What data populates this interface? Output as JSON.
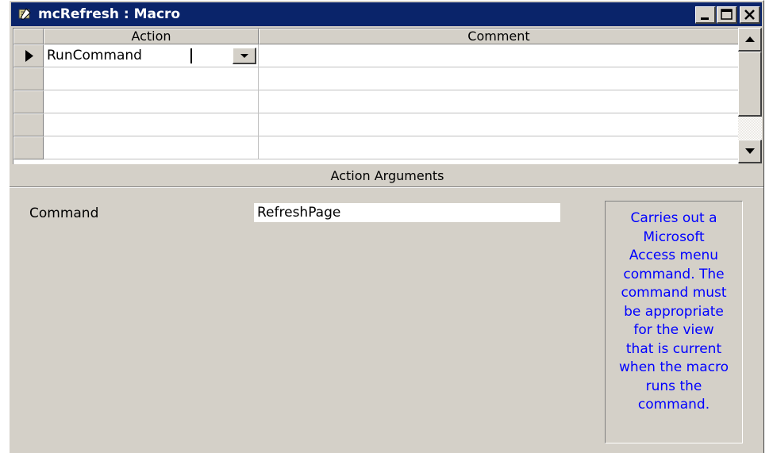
{
  "window": {
    "title": "mcRefresh : Macro"
  },
  "grid": {
    "columns": [
      "Action",
      "Comment"
    ],
    "rows": [
      {
        "action": "RunCommand",
        "comment": ""
      },
      {
        "action": "",
        "comment": ""
      },
      {
        "action": "",
        "comment": ""
      },
      {
        "action": "",
        "comment": ""
      },
      {
        "action": "",
        "comment": ""
      }
    ]
  },
  "arguments": {
    "section_title": "Action Arguments",
    "command_label": "Command",
    "command_value": "RefreshPage"
  },
  "help": {
    "lines": [
      "Carries out a",
      "Microsoft",
      "Access menu",
      "command. The",
      "command must",
      "be appropriate",
      "for the view",
      "that is current",
      "when the macro",
      "runs the",
      "command."
    ]
  },
  "colors": {
    "titlebar": "#0a246a",
    "face": "#d4d0c8",
    "help_text": "#0000ff"
  }
}
